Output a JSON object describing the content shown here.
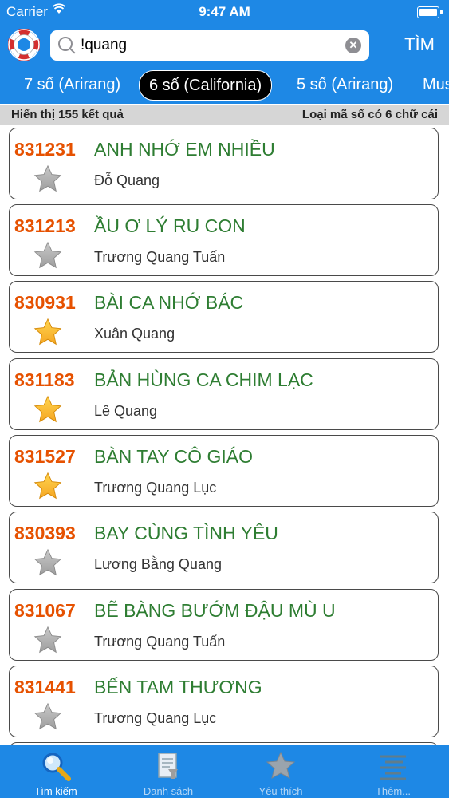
{
  "status": {
    "carrier": "Carrier",
    "time": "9:47 AM"
  },
  "search": {
    "value": "!quang",
    "button": "TÌM"
  },
  "tabs": [
    {
      "label": "7 số (Arirang)"
    },
    {
      "label": "6 số (California)"
    },
    {
      "label": "5 số (Arirang)"
    },
    {
      "label": "Mus"
    }
  ],
  "info": {
    "count": "Hiển thị 155 kết quả",
    "type": "Loại mã số có 6 chữ cái"
  },
  "songs": [
    {
      "code": "831231",
      "title": "ANH NHỚ EM NHIỀU",
      "author": "Đỗ Quang",
      "favorite": false
    },
    {
      "code": "831213",
      "title": "ẦU Ơ LÝ RU CON",
      "author": "Trương Quang Tuấn",
      "favorite": false
    },
    {
      "code": "830931",
      "title": "BÀI CA NHỚ BÁC",
      "author": "Xuân Quang",
      "favorite": true
    },
    {
      "code": "831183",
      "title": "BẢN HÙNG CA CHIM LẠC",
      "author": "Lê Quang",
      "favorite": true
    },
    {
      "code": "831527",
      "title": "BÀN TAY CÔ GIÁO",
      "author": "Trương Quang Lục",
      "favorite": true
    },
    {
      "code": "830393",
      "title": "BAY CÙNG TÌNH YÊU",
      "author": "Lương Bằng Quang",
      "favorite": false
    },
    {
      "code": "831067",
      "title": "BẼ BÀNG BƯỚM ĐẬU MÙ U",
      "author": "Trương Quang Tuấn",
      "favorite": false
    },
    {
      "code": "831441",
      "title": "BẾN TAM THƯƠNG",
      "author": "Trương Quang Lục",
      "favorite": false
    }
  ],
  "tabbar": {
    "search": "Tìm kiếm",
    "list": "Danh sách",
    "favorites": "Yêu thích",
    "more": "Thêm..."
  },
  "colors": {
    "bar": "#1e88e5",
    "code": "#e65100",
    "title": "#2e7d32"
  }
}
